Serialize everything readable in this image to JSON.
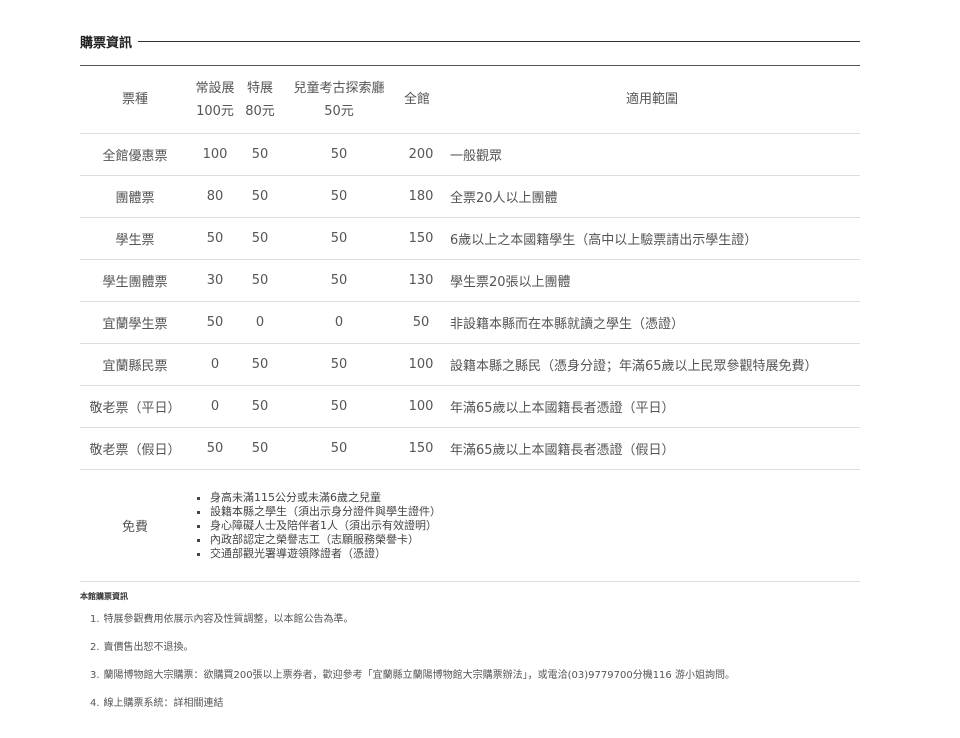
{
  "section": {
    "title": "購票資訊"
  },
  "table": {
    "headers": {
      "type": "票種",
      "regular": {
        "name": "常設展",
        "price": "100元"
      },
      "special": {
        "name": "特展",
        "price": "80元"
      },
      "kids": {
        "name": "兒童考古探索廳",
        "price": "50元"
      },
      "all": "全館",
      "scope": "適用範圍"
    },
    "rows": [
      {
        "type": "全館優惠票",
        "regular": "100",
        "special": "50",
        "kids": "50",
        "all": "200",
        "scope": "一般觀眾"
      },
      {
        "type": "團體票",
        "regular": "80",
        "special": "50",
        "kids": "50",
        "all": "180",
        "scope": "全票20人以上團體"
      },
      {
        "type": "學生票",
        "regular": "50",
        "special": "50",
        "kids": "50",
        "all": "150",
        "scope": "6歲以上之本國籍學生（高中以上驗票請出示學生證）"
      },
      {
        "type": "學生團體票",
        "regular": "30",
        "special": "50",
        "kids": "50",
        "all": "130",
        "scope": "學生票20張以上團體"
      },
      {
        "type": "宜蘭學生票",
        "regular": "50",
        "special": "0",
        "kids": "0",
        "all": "50",
        "scope": "非設籍本縣而在本縣就讀之學生（憑證）"
      },
      {
        "type": "宜蘭縣民票",
        "regular": "0",
        "special": "50",
        "kids": "50",
        "all": "100",
        "scope": "設籍本縣之縣民（憑身分證；年滿65歲以上民眾參觀特展免費）"
      },
      {
        "type": "敬老票（平日）",
        "regular": "0",
        "special": "50",
        "kids": "50",
        "all": "100",
        "scope": "年滿65歲以上本國籍長者憑證（平日）"
      },
      {
        "type": "敬老票（假日）",
        "regular": "50",
        "special": "50",
        "kids": "50",
        "all": "150",
        "scope": "年滿65歲以上本國籍長者憑證（假日）"
      }
    ],
    "free": {
      "type": "免費",
      "items": [
        "身高未滿115公分或未滿6歲之兒童",
        "設籍本縣之學生（須出示身分證件與學生證件）",
        "身心障礙人士及陪伴者1人（須出示有效證明）",
        "內政部認定之榮譽志工（志願服務榮譽卡）",
        "交通部觀光署導遊領隊證者（憑證）"
      ]
    }
  },
  "notes": {
    "title": "本館購票資訊",
    "items": [
      {
        "num": "1.",
        "text": "特展參觀費用依展示內容及性質調整，以本館公告為準。"
      },
      {
        "num": "2.",
        "text": "賣價售出恕不退換。"
      },
      {
        "num": "3.",
        "text": "蘭陽博物館大宗購票：欲購買200張以上票券者，歡迎參考「宜蘭縣立蘭陽博物館大宗購票辦法」，或電洽(03)9779700分機116 游小姐詢問。"
      },
      {
        "num": "4.",
        "text": "線上購票系統：詳相關連結"
      }
    ]
  }
}
